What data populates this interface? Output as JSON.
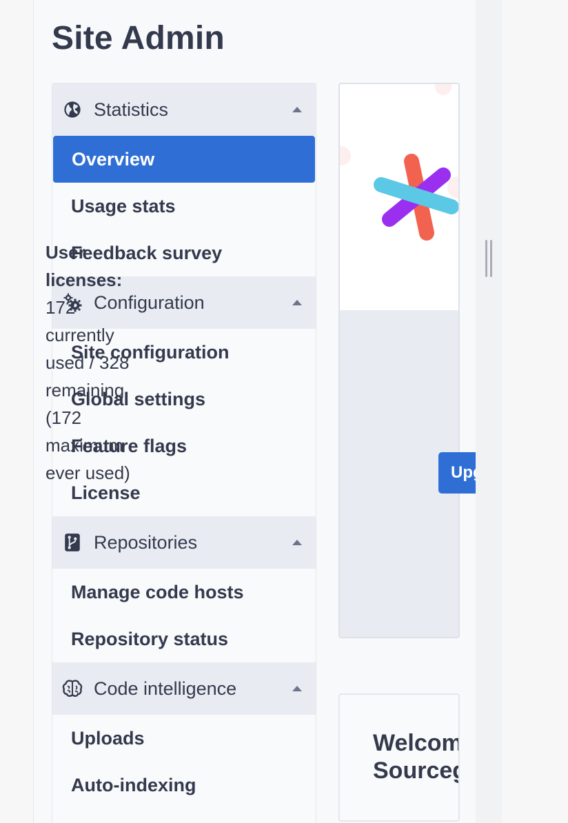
{
  "page": {
    "title": "Site Admin"
  },
  "sidebar": {
    "groups": [
      {
        "label": "Statistics",
        "icon": "globe-icon",
        "items": [
          "Overview",
          "Usage stats",
          "Feedback survey"
        ]
      },
      {
        "label": "Configuration",
        "icon": "cogs-icon",
        "items": [
          "Site configuration",
          "Global settings",
          "Feature flags",
          "License"
        ]
      },
      {
        "label": "Repositories",
        "icon": "source-branch-icon",
        "items": [
          "Manage code hosts",
          "Repository status"
        ]
      },
      {
        "label": "Code intelligence",
        "icon": "brain-icon",
        "items": [
          "Uploads",
          "Auto-indexing"
        ]
      }
    ],
    "active_item": "Overview"
  },
  "license_card": {
    "heading": "User licenses:",
    "body": "172 currently used / 328 remaining (172 maximum ever used)",
    "used": 172,
    "remaining": 328,
    "max_used": 172
  },
  "upgrade_button": {
    "label": "Upgrade"
  },
  "welcome_card": {
    "line1": "Welcome",
    "line2": "Sourcegraph"
  },
  "colors": {
    "accent": "#2f6fd5",
    "text": "#343a4d",
    "group_header_bg": "#e8ebf2",
    "logo_orange": "#f1634f",
    "logo_purple": "#9b2ff0",
    "logo_cyan": "#5bc8e6"
  }
}
